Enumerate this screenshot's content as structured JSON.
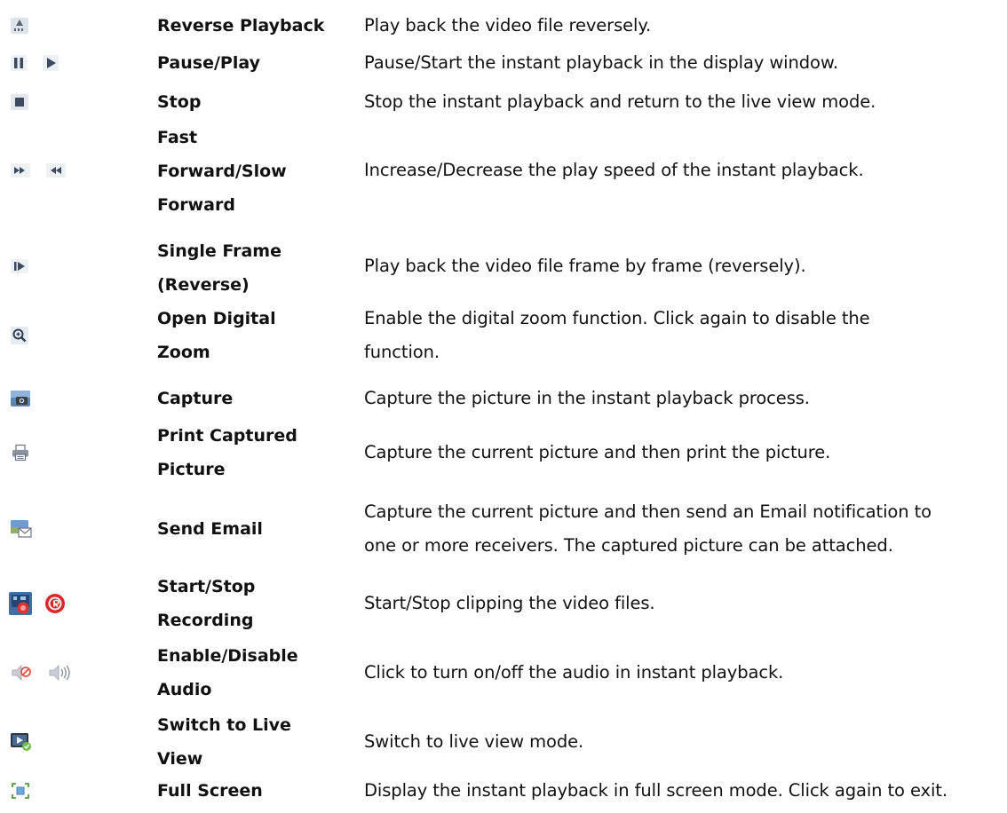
{
  "rows": [
    {
      "icons": [
        "reverse-playback-icon"
      ],
      "label": "Reverse Playback",
      "description": "Play back the video file reversely."
    },
    {
      "icons": [
        "pause-icon",
        "play-icon"
      ],
      "label": "Pause/Play",
      "description": "Pause/Start the instant playback in the display window."
    },
    {
      "icons": [
        "stop-icon"
      ],
      "label": "Stop",
      "description": "Stop the instant playback and return to the live view mode."
    },
    {
      "icons": [
        "fast-forward-icon",
        "slow-forward-icon"
      ],
      "label_lines": [
        "Fast",
        "Forward/Slow",
        "Forward"
      ],
      "description": "Increase/Decrease the play speed of the instant playback."
    },
    {
      "icons": [
        "single-frame-icon"
      ],
      "label_lines": [
        "Single Frame",
        "(Reverse)"
      ],
      "description": "Play back the video file frame by frame (reversely)."
    },
    {
      "icons": [
        "digital-zoom-icon"
      ],
      "label_lines": [
        "Open Digital",
        "Zoom"
      ],
      "description_lines": [
        "Enable the digital zoom function. Click again to disable the",
        "function."
      ]
    },
    {
      "icons": [
        "capture-icon"
      ],
      "label": "Capture",
      "description": "Capture the picture in the instant playback process."
    },
    {
      "icons": [
        "print-icon"
      ],
      "label_lines": [
        "Print Captured",
        "Picture"
      ],
      "description": "Capture the current picture and then print the picture."
    },
    {
      "icons": [
        "send-email-icon"
      ],
      "label": "Send Email",
      "description_lines": [
        "Capture the current picture and then send an Email notification to",
        "one or more receivers. The captured picture can be attached."
      ]
    },
    {
      "icons": [
        "start-recording-icon",
        "stop-recording-icon"
      ],
      "label_lines": [
        "Start/Stop",
        "Recording"
      ],
      "description": "Start/Stop clipping the video files."
    },
    {
      "icons": [
        "audio-disabled-icon",
        "audio-enabled-icon"
      ],
      "label_lines": [
        "Enable/Disable",
        "Audio"
      ],
      "description": "Click to turn on/off the audio in instant playback."
    },
    {
      "icons": [
        "switch-live-view-icon"
      ],
      "label_lines": [
        "Switch to Live",
        "View"
      ],
      "description": "Switch to live view mode."
    },
    {
      "icons": [
        "full-screen-icon"
      ],
      "label": "Full Screen",
      "description": "Display the instant playback in full screen mode. Click again to exit."
    }
  ]
}
